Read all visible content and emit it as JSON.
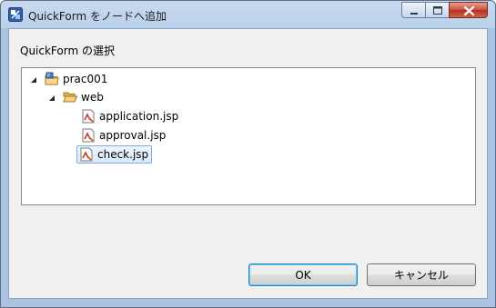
{
  "window": {
    "title": "QuickForm をノードへ追加"
  },
  "dialog": {
    "section_label": "QuickForm の選択",
    "ok_label": "OK",
    "cancel_label": "キャンセル"
  },
  "tree": {
    "nodes": [
      {
        "label": "prac001",
        "icon": "project-folder-icon",
        "expanded": true,
        "level": 0
      },
      {
        "label": "web",
        "icon": "folder-open-icon",
        "expanded": true,
        "level": 1
      },
      {
        "label": "application.jsp",
        "icon": "jsp-file-icon",
        "level": 2
      },
      {
        "label": "approval.jsp",
        "icon": "jsp-file-icon",
        "level": 2
      },
      {
        "label": "check.jsp",
        "icon": "jsp-file-icon",
        "level": 2,
        "selected": true
      }
    ]
  },
  "colors": {
    "selection_border": "#84acdd",
    "close_button": "#c75043",
    "window_frame": "#b9d1ea"
  }
}
